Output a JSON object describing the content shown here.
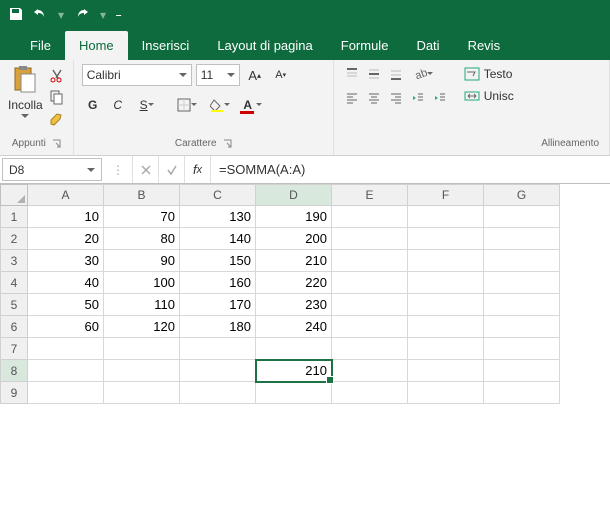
{
  "qat": {
    "save_icon": "save",
    "undo_icon": "undo",
    "redo_icon": "redo"
  },
  "tabs": {
    "items": [
      "File",
      "Home",
      "Inserisci",
      "Layout di pagina",
      "Formule",
      "Dati",
      "Revis"
    ],
    "active_index": 1
  },
  "ribbon": {
    "clipboard": {
      "paste_label": "Incolla",
      "group_label": "Appunti"
    },
    "font": {
      "family": "Calibri",
      "size": "11",
      "bold": "G",
      "italic": "C",
      "underline": "S",
      "group_label": "Carattere"
    },
    "alignment": {
      "wrap_label": "Testo",
      "merge_label": "Unisc",
      "group_label": "Allineamento"
    }
  },
  "namebox": "D8",
  "formula": "=SOMMA(A:A)",
  "columns": [
    "A",
    "B",
    "C",
    "D",
    "E",
    "F",
    "G"
  ],
  "row_headers": [
    "1",
    "2",
    "3",
    "4",
    "5",
    "6",
    "7",
    "8",
    "9"
  ],
  "selected_col_index": 3,
  "selected_row_index": 7,
  "cells": {
    "r1": [
      "10",
      "70",
      "130",
      "190",
      "",
      "",
      ""
    ],
    "r2": [
      "20",
      "80",
      "140",
      "200",
      "",
      "",
      ""
    ],
    "r3": [
      "30",
      "90",
      "150",
      "210",
      "",
      "",
      ""
    ],
    "r4": [
      "40",
      "100",
      "160",
      "220",
      "",
      "",
      ""
    ],
    "r5": [
      "50",
      "110",
      "170",
      "230",
      "",
      "",
      ""
    ],
    "r6": [
      "60",
      "120",
      "180",
      "240",
      "",
      "",
      ""
    ],
    "r7": [
      "",
      "",
      "",
      "",
      "",
      "",
      ""
    ],
    "r8": [
      "",
      "",
      "",
      "210",
      "",
      "",
      ""
    ],
    "r9": [
      "",
      "",
      "",
      "",
      "",
      "",
      ""
    ]
  }
}
